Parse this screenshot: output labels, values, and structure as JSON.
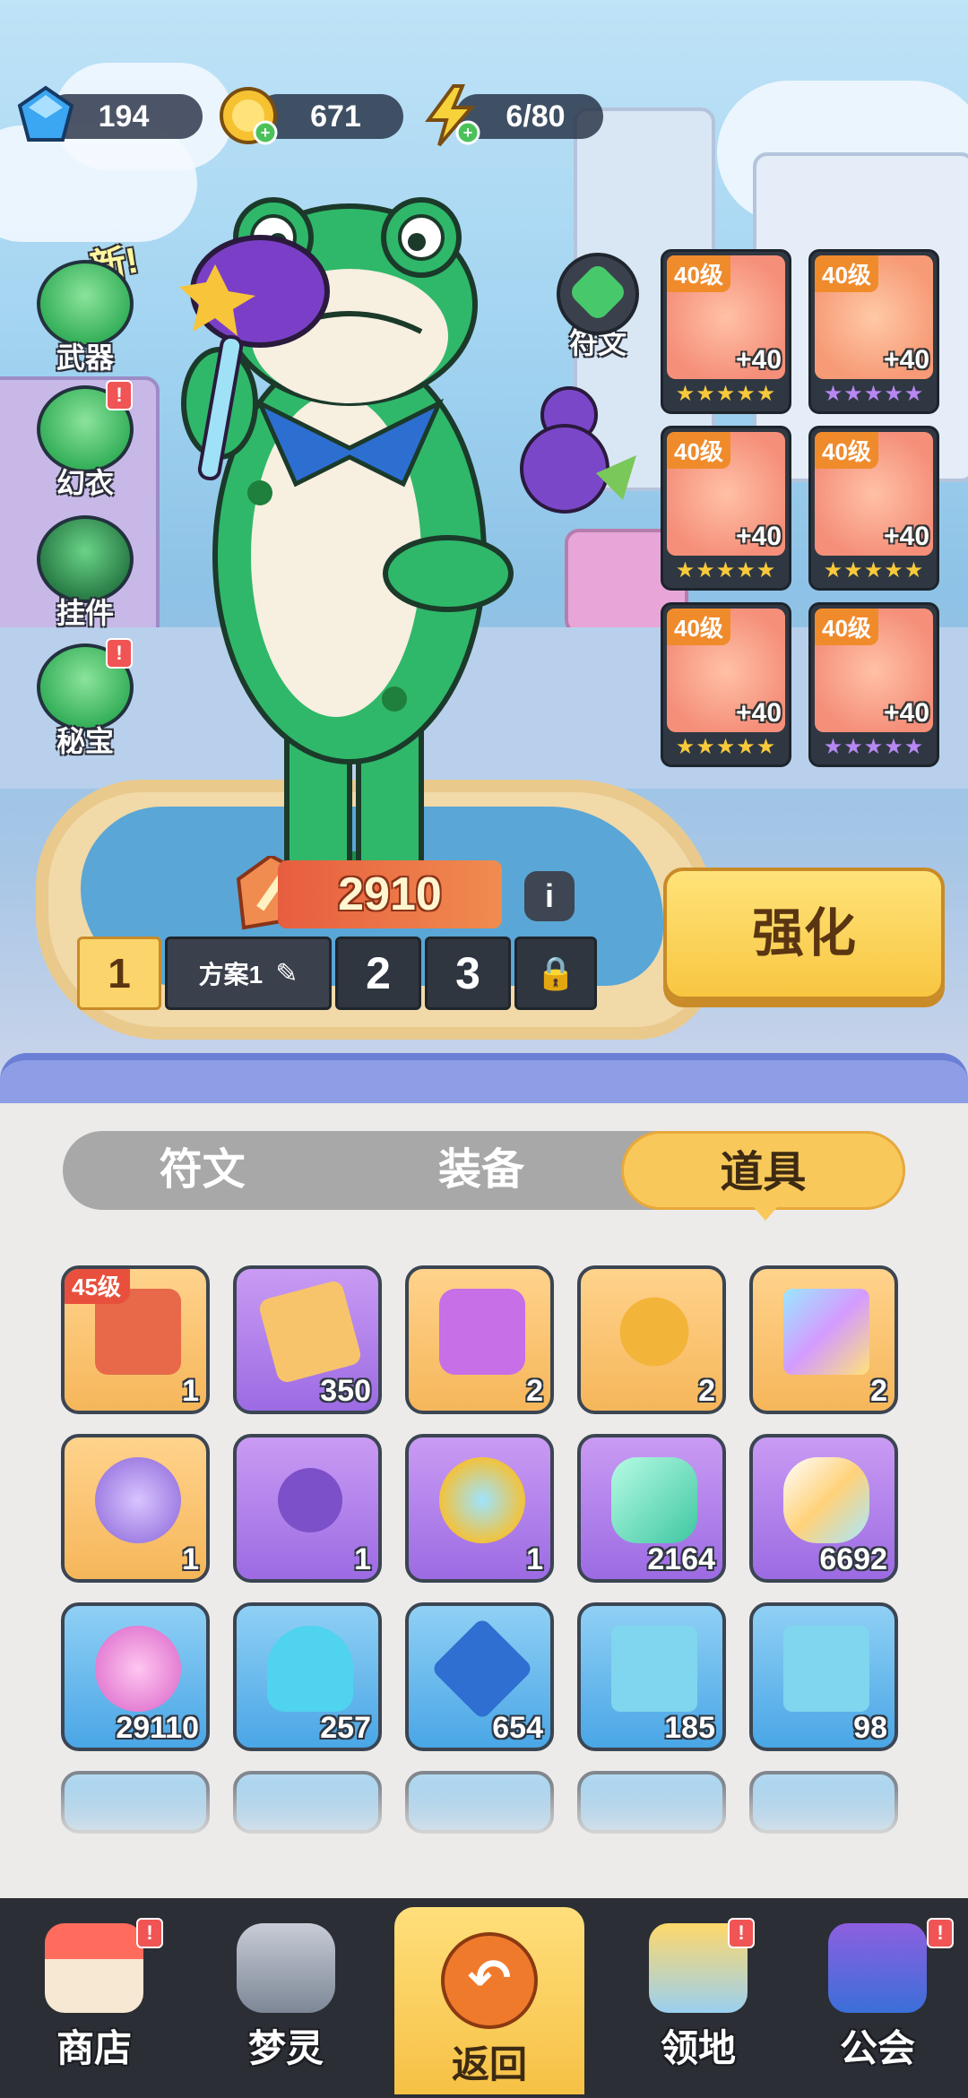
{
  "currency": {
    "gems": "194",
    "gold": "671",
    "energy": "6/80"
  },
  "side_menu": {
    "new_tag": "新!",
    "weapon": "武器",
    "costume": "幻衣",
    "pendant": "挂件",
    "treasure": "秘宝",
    "alert": "!"
  },
  "rune_button": "符文",
  "equipment": [
    {
      "level": "40级",
      "plus": "+40",
      "stars": "★★★★★"
    },
    {
      "level": "40级",
      "plus": "+40",
      "stars": "★★★★★"
    },
    {
      "level": "40级",
      "plus": "+40",
      "stars": "★★★★★"
    },
    {
      "level": "40级",
      "plus": "+40",
      "stars": "★★★★★"
    },
    {
      "level": "40级",
      "plus": "+40",
      "stars": "★★★★★"
    },
    {
      "level": "40级",
      "plus": "+40",
      "stars": "★★★★★"
    }
  ],
  "power": "2910",
  "info": "i",
  "plans": {
    "current_num": "1",
    "current_name": "方案1",
    "p2": "2",
    "p3": "3"
  },
  "strengthen": "强化",
  "tabs": [
    "符文",
    "装备",
    "道具"
  ],
  "inventory": [
    {
      "count": "1",
      "badge": "45级"
    },
    {
      "count": "350"
    },
    {
      "count": "2"
    },
    {
      "count": "2"
    },
    {
      "count": "2"
    },
    {
      "count": "1"
    },
    {
      "count": "1"
    },
    {
      "count": "1"
    },
    {
      "count": "2164"
    },
    {
      "count": "6692"
    },
    {
      "count": "29110"
    },
    {
      "count": "257"
    },
    {
      "count": "654"
    },
    {
      "count": "185"
    },
    {
      "count": "98"
    }
  ],
  "bottom_nav": {
    "shop": "商店",
    "dream": "梦灵",
    "back": "返回",
    "territory": "领地",
    "guild": "公会",
    "alert": "!"
  }
}
